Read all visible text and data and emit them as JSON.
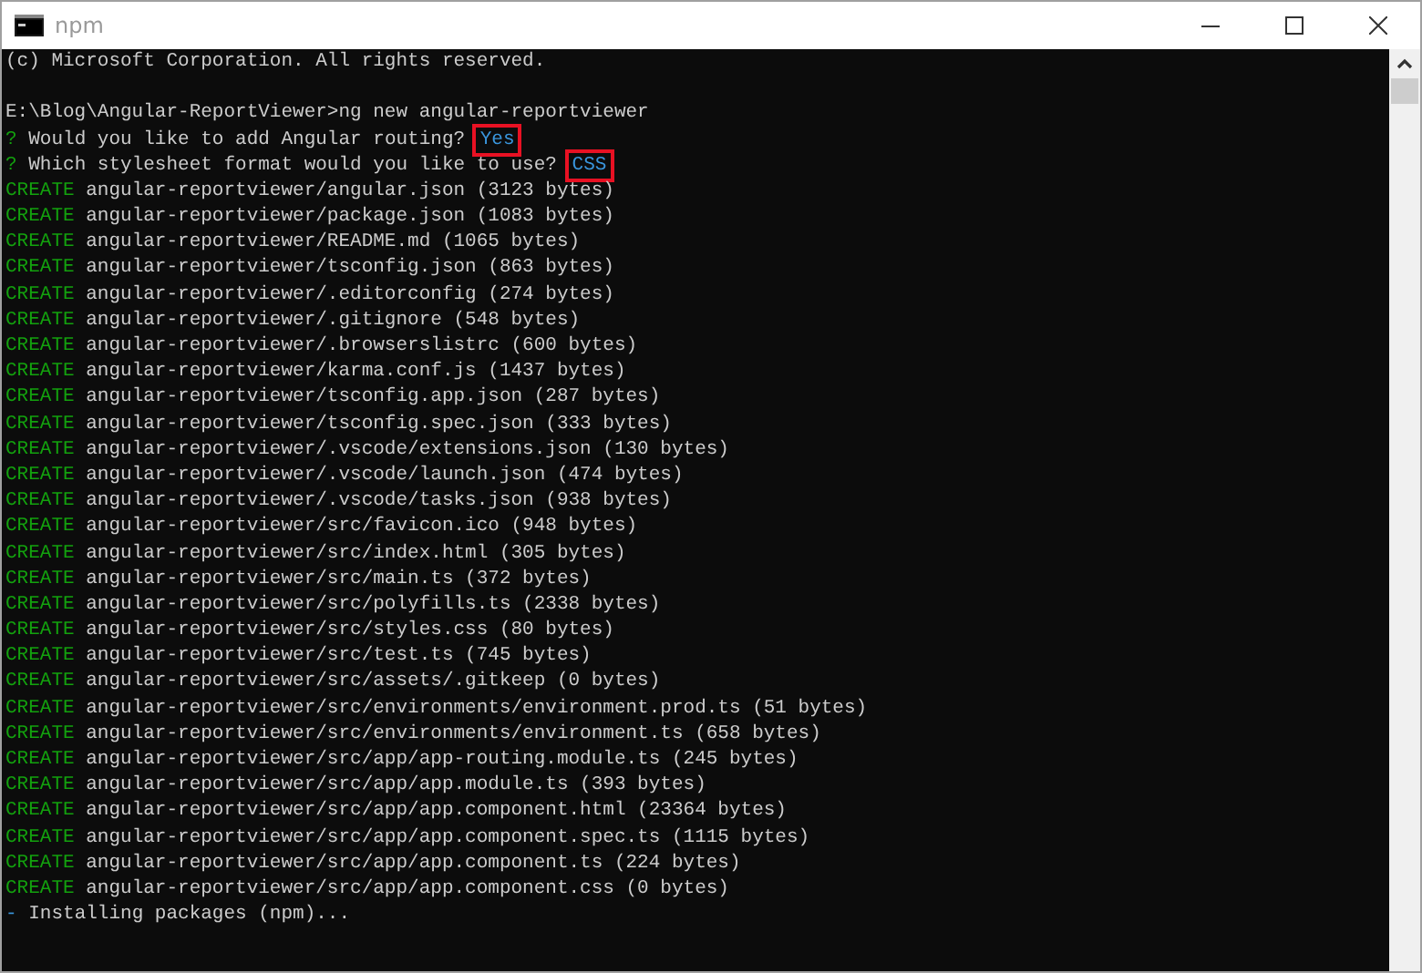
{
  "window": {
    "title": "npm"
  },
  "console": {
    "lines": [
      [
        {
          "kind": "plain",
          "text": "(c) Microsoft Corporation. All rights reserved."
        }
      ],
      [
        {
          "kind": "blank"
        }
      ],
      [
        {
          "kind": "plain",
          "text": "E:\\Blog\\Angular-ReportViewer>ng new angular-reportviewer"
        }
      ],
      [
        {
          "kind": "prompt",
          "text": "?"
        },
        {
          "kind": "plain",
          "text": "Would you like to add Angular routing?"
        },
        {
          "kind": "answer",
          "text": "Yes"
        }
      ],
      [
        {
          "kind": "prompt",
          "text": "?"
        },
        {
          "kind": "plain",
          "text": "Which stylesheet format would you like to use?"
        },
        {
          "kind": "answer",
          "text": "CSS"
        }
      ],
      [
        {
          "kind": "keyword",
          "text": "CREATE"
        },
        {
          "kind": "plain",
          "text": "angular-reportviewer/angular.json (3123 bytes)"
        }
      ],
      [
        {
          "kind": "keyword",
          "text": "CREATE"
        },
        {
          "kind": "plain",
          "text": "angular-reportviewer/package.json (1083 bytes)"
        }
      ],
      [
        {
          "kind": "keyword",
          "text": "CREATE"
        },
        {
          "kind": "plain",
          "text": "angular-reportviewer/README.md (1065 bytes)"
        }
      ],
      [
        {
          "kind": "keyword",
          "text": "CREATE"
        },
        {
          "kind": "plain",
          "text": "angular-reportviewer/tsconfig.json (863 bytes)"
        }
      ],
      [
        {
          "kind": "keyword",
          "text": "CREATE"
        },
        {
          "kind": "plain",
          "text": "angular-reportviewer/.editorconfig (274 bytes)"
        }
      ],
      [
        {
          "kind": "keyword",
          "text": "CREATE"
        },
        {
          "kind": "plain",
          "text": "angular-reportviewer/.gitignore (548 bytes)"
        }
      ],
      [
        {
          "kind": "keyword",
          "text": "CREATE"
        },
        {
          "kind": "plain",
          "text": "angular-reportviewer/.browserslistrc (600 bytes)"
        }
      ],
      [
        {
          "kind": "keyword",
          "text": "CREATE"
        },
        {
          "kind": "plain",
          "text": "angular-reportviewer/karma.conf.js (1437 bytes)"
        }
      ],
      [
        {
          "kind": "keyword",
          "text": "CREATE"
        },
        {
          "kind": "plain",
          "text": "angular-reportviewer/tsconfig.app.json (287 bytes)"
        }
      ],
      [
        {
          "kind": "keyword",
          "text": "CREATE"
        },
        {
          "kind": "plain",
          "text": "angular-reportviewer/tsconfig.spec.json (333 bytes)"
        }
      ],
      [
        {
          "kind": "keyword",
          "text": "CREATE"
        },
        {
          "kind": "plain",
          "text": "angular-reportviewer/.vscode/extensions.json (130 bytes)"
        }
      ],
      [
        {
          "kind": "keyword",
          "text": "CREATE"
        },
        {
          "kind": "plain",
          "text": "angular-reportviewer/.vscode/launch.json (474 bytes)"
        }
      ],
      [
        {
          "kind": "keyword",
          "text": "CREATE"
        },
        {
          "kind": "plain",
          "text": "angular-reportviewer/.vscode/tasks.json (938 bytes)"
        }
      ],
      [
        {
          "kind": "keyword",
          "text": "CREATE"
        },
        {
          "kind": "plain",
          "text": "angular-reportviewer/src/favicon.ico (948 bytes)"
        }
      ],
      [
        {
          "kind": "keyword",
          "text": "CREATE"
        },
        {
          "kind": "plain",
          "text": "angular-reportviewer/src/index.html (305 bytes)"
        }
      ],
      [
        {
          "kind": "keyword",
          "text": "CREATE"
        },
        {
          "kind": "plain",
          "text": "angular-reportviewer/src/main.ts (372 bytes)"
        }
      ],
      [
        {
          "kind": "keyword",
          "text": "CREATE"
        },
        {
          "kind": "plain",
          "text": "angular-reportviewer/src/polyfills.ts (2338 bytes)"
        }
      ],
      [
        {
          "kind": "keyword",
          "text": "CREATE"
        },
        {
          "kind": "plain",
          "text": "angular-reportviewer/src/styles.css (80 bytes)"
        }
      ],
      [
        {
          "kind": "keyword",
          "text": "CREATE"
        },
        {
          "kind": "plain",
          "text": "angular-reportviewer/src/test.ts (745 bytes)"
        }
      ],
      [
        {
          "kind": "keyword",
          "text": "CREATE"
        },
        {
          "kind": "plain",
          "text": "angular-reportviewer/src/assets/.gitkeep (0 bytes)"
        }
      ],
      [
        {
          "kind": "keyword",
          "text": "CREATE"
        },
        {
          "kind": "plain",
          "text": "angular-reportviewer/src/environments/environment.prod.ts (51 bytes)"
        }
      ],
      [
        {
          "kind": "keyword",
          "text": "CREATE"
        },
        {
          "kind": "plain",
          "text": "angular-reportviewer/src/environments/environment.ts (658 bytes)"
        }
      ],
      [
        {
          "kind": "keyword",
          "text": "CREATE"
        },
        {
          "kind": "plain",
          "text": "angular-reportviewer/src/app/app-routing.module.ts (245 bytes)"
        }
      ],
      [
        {
          "kind": "keyword",
          "text": "CREATE"
        },
        {
          "kind": "plain",
          "text": "angular-reportviewer/src/app/app.module.ts (393 bytes)"
        }
      ],
      [
        {
          "kind": "keyword",
          "text": "CREATE"
        },
        {
          "kind": "plain",
          "text": "angular-reportviewer/src/app/app.component.html (23364 bytes)"
        }
      ],
      [
        {
          "kind": "keyword",
          "text": "CREATE"
        },
        {
          "kind": "plain",
          "text": "angular-reportviewer/src/app/app.component.spec.ts (1115 bytes)"
        }
      ],
      [
        {
          "kind": "keyword",
          "text": "CREATE"
        },
        {
          "kind": "plain",
          "text": "angular-reportviewer/src/app/app.component.ts (224 bytes)"
        }
      ],
      [
        {
          "kind": "keyword",
          "text": "CREATE"
        },
        {
          "kind": "plain",
          "text": "angular-reportviewer/src/app/app.component.css (0 bytes)"
        }
      ],
      [
        {
          "kind": "spinner",
          "text": "-"
        },
        {
          "kind": "plain",
          "text": "Installing packages (npm)..."
        }
      ]
    ]
  }
}
